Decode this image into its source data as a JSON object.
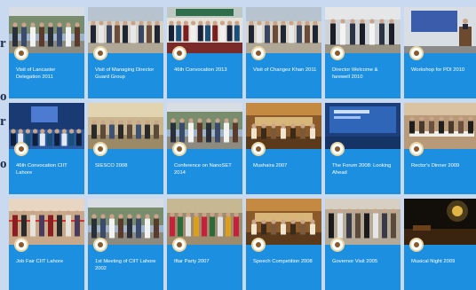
{
  "side_glyphs": [
    "r",
    "o",
    "r",
    "o"
  ],
  "cards": [
    {
      "title": "Visit of Lancaster Delegation 2011",
      "icon": "college-badge-icon",
      "thumb": "group-photo-outdoor"
    },
    {
      "title": "Visit of Managing Director Guard Group",
      "icon": "college-badge-icon",
      "thumb": "group-photo-row"
    },
    {
      "title": "46th Convocation 2013",
      "icon": "college-badge-icon",
      "thumb": "convocation-stage"
    },
    {
      "title": "Visit of Changez Khan 2011",
      "icon": "college-badge-icon",
      "thumb": "group-photo-row"
    },
    {
      "title": "Director Welcome & farewell 2010",
      "icon": "college-badge-icon",
      "thumb": "group-photo-suits"
    },
    {
      "title": "Workshop for PDI 2010",
      "icon": "college-badge-icon",
      "thumb": "lecture-podium"
    },
    {
      "title": "46th Convocation CIIT Lahore",
      "icon": "college-badge-icon",
      "thumb": "convocation-hall"
    },
    {
      "title": "SIESCO 2008",
      "icon": "college-badge-icon",
      "thumb": "audience-hall"
    },
    {
      "title": "Conference on NanoSET 2014",
      "icon": "college-badge-icon",
      "thumb": "group-photo-outdoor"
    },
    {
      "title": "Mushaira 2007",
      "icon": "college-badge-icon",
      "thumb": "evening-tent"
    },
    {
      "title": "The Forum 2008: Looking Ahead",
      "icon": "college-badge-icon",
      "thumb": "forum-screen"
    },
    {
      "title": "Rector's Dinner 2009",
      "icon": "college-badge-icon",
      "thumb": "dinner-hall"
    },
    {
      "title": "Job Fair CIIT Lahore",
      "icon": "college-badge-icon",
      "thumb": "ribbon-cutting"
    },
    {
      "title": "1st Meeting of CIIT Lahore 2002",
      "icon": "college-badge-icon",
      "thumb": "group-photo-outdoor"
    },
    {
      "title": "Iftar Party 2007",
      "icon": "college-badge-icon",
      "thumb": "crowd-outdoor"
    },
    {
      "title": "Speech Competition 2008",
      "icon": "college-badge-icon",
      "thumb": "evening-tent"
    },
    {
      "title": "Governor Visit 2005",
      "icon": "college-badge-icon",
      "thumb": "crowd-suits"
    },
    {
      "title": "Musical Night 2009",
      "icon": "college-badge-icon",
      "thumb": "night-lights"
    }
  ],
  "colors": {
    "card": "#1d8fe0",
    "page": "#c9daf0",
    "caption": "#ffffff"
  }
}
